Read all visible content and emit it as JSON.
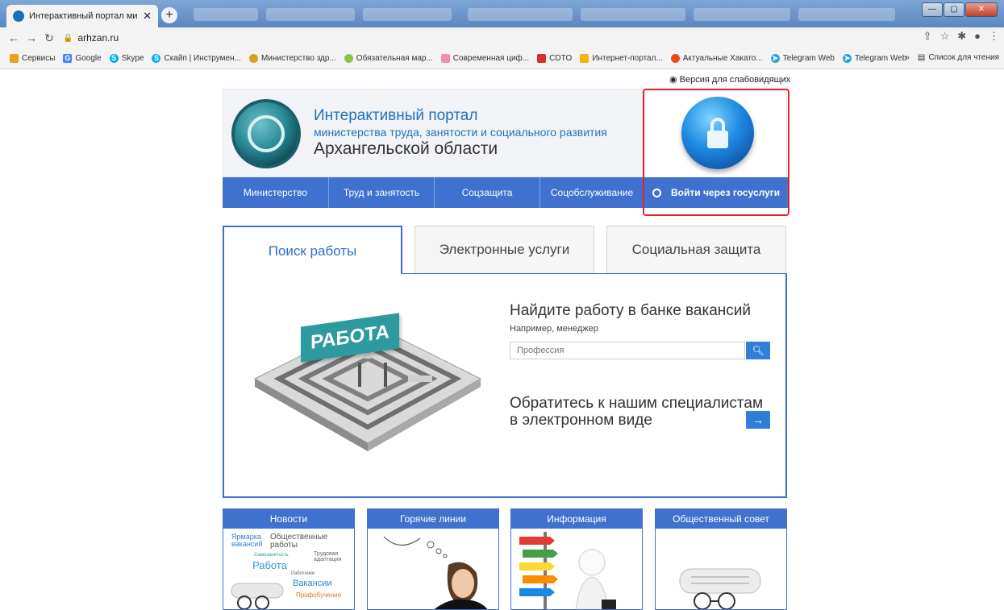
{
  "browser": {
    "active_tab_title": "Интерактивный портал минист",
    "new_tab": "+",
    "url": "arhzan.ru",
    "bookmarks": [
      {
        "label": "Сервисы",
        "color": "#e8a21c",
        "icon": "apps-icon"
      },
      {
        "label": "Google",
        "color": "#4285f4",
        "icon": "google-icon"
      },
      {
        "label": "Skype",
        "color": "#00aff0",
        "icon": "skype-icon"
      },
      {
        "label": "Скайп | Инструмен...",
        "color": "#00aff0",
        "icon": "skype-icon"
      },
      {
        "label": "Министерство здр...",
        "color": "#d2a31e",
        "icon": "emblem-icon"
      },
      {
        "label": "Обязательная мар...",
        "color": "#8bc34a",
        "icon": "mark-icon"
      },
      {
        "label": "Современная циф...",
        "color": "#f08fb0",
        "icon": "page-icon"
      },
      {
        "label": "CDTO",
        "color": "#d32f2f",
        "icon": "cdto-icon"
      },
      {
        "label": "Интернет-портал...",
        "color": "#f5b400",
        "icon": "portal-icon"
      },
      {
        "label": "Актуальные Хакато...",
        "color": "#e64a19",
        "icon": "hackathon-icon"
      },
      {
        "label": "Telegram Web",
        "color": "#2aa3dd",
        "icon": "telegram-icon"
      },
      {
        "label": "Telegram Web",
        "color": "#2aa3dd",
        "icon": "telegram-icon"
      }
    ],
    "more_bookmarks": "»",
    "reading_list": "Список для чтения"
  },
  "page": {
    "low_vision_link": "Версия для слабовидящих",
    "portal_title_1": "Интерактивный портал",
    "portal_title_2": "министерства труда, занятости и социального развития",
    "portal_title_3": "Архангельской области",
    "nav": [
      "Министерство",
      "Труд и занятость",
      "Соцзащита",
      "Соцобслуживание"
    ],
    "gosuslugi_button": "Войти через госуслуги",
    "tabs": [
      "Поиск работы",
      "Электронные услуги",
      "Социальная защита"
    ],
    "maze_sign": "РАБОТА",
    "find_title": "Найдите работу в банке вакансий",
    "find_hint": "Например, менеджер",
    "search_placeholder": "Профессия",
    "contact_title_1": "Обратитесь к нашим специалистам",
    "contact_title_2": "в электронном виде",
    "cards": [
      "Новости",
      "Горячие линии",
      "Информация",
      "Общественный совет"
    ],
    "news_cloud": [
      "Ярмарка вакансий",
      "Общественные работы",
      "Самозанятость",
      "Работа",
      "Трудовая адаптация",
      "Работники",
      "Вакансии",
      "Профобучение"
    ]
  },
  "colors": {
    "nav_blue": "#4171cf",
    "accent_red": "#e0252a",
    "title_blue": "#1e73be"
  }
}
